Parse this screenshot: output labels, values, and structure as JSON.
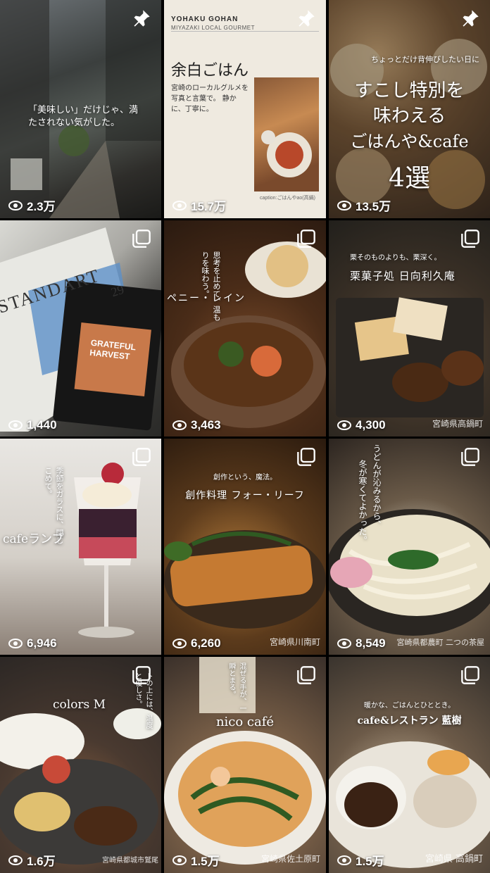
{
  "tiles": [
    {
      "id": "t1",
      "views": "2.3万",
      "pinned": true,
      "text": "「美味しい」だけじゃ、満たされない気がした。"
    },
    {
      "id": "t2",
      "views": "15.7万",
      "pinned": true,
      "brand": "YOHAKU GOHAN",
      "brand_sub": "MIYAZAKI LOCAL GOURMET",
      "title": "余白ごはん",
      "body": "宮崎のローカルグルメを 写真と言葉で。 静かに、丁寧に。",
      "caption": "caption:ごはんやao(高鍋)"
    },
    {
      "id": "t3",
      "views": "13.5万",
      "pinned": true,
      "small": "ちょっとだけ背伸びしたい日に",
      "line1": "すこし特別を",
      "line2": "味わえる",
      "line3": "ごはんや&cafe",
      "line4": "4選"
    },
    {
      "id": "t4",
      "views": "1,440",
      "multi": true,
      "magazine": "STANDART",
      "mag_no": "29",
      "pack1": "GRATEFUL",
      "pack2": "HARVEST"
    },
    {
      "id": "t5",
      "views": "3,463",
      "multi": true,
      "name": "ペニー・レイン",
      "vert": "思考を止めて、温もりを味わう。"
    },
    {
      "id": "t6",
      "views": "4,300",
      "multi": true,
      "vert": "栗そのものよりも、栗深く。",
      "name": "栗菓子処 日向利久庵",
      "loc": "宮崎県高鍋町"
    },
    {
      "id": "t7",
      "views": "6,946",
      "multi": true,
      "vert": "季節をガラスに、閉じこめて。",
      "name": "cafeランプ"
    },
    {
      "id": "t8",
      "views": "6,260",
      "multi": true,
      "small": "創作という、魔法。",
      "name": "創作料理 フォー・リーフ",
      "loc": "宮崎県川南町"
    },
    {
      "id": "t9",
      "views": "8,549",
      "multi": true,
      "vert1": "うどんが沁みるから、",
      "vert2": "冬が寒くてよかった。",
      "loc": "宮崎県都農町 二つの茶屋"
    },
    {
      "id": "t10",
      "views": "1.6万",
      "multi": true,
      "name": "colors M",
      "vert": "トの上には、温度と優しさ。",
      "loc": "宮崎県都城市鷲尾"
    },
    {
      "id": "t11",
      "views": "1.5万",
      "multi": true,
      "vert": "混ぜる手が、一瞬とまる。",
      "name": "nico café",
      "loc": "宮崎県佐土原町"
    },
    {
      "id": "t12",
      "views": "1.5万",
      "multi": true,
      "small": "暖かな、ごはんとひととき。",
      "name": "cafe&レストラン 藍樹",
      "loc": "宮崎県 高鍋町"
    }
  ]
}
